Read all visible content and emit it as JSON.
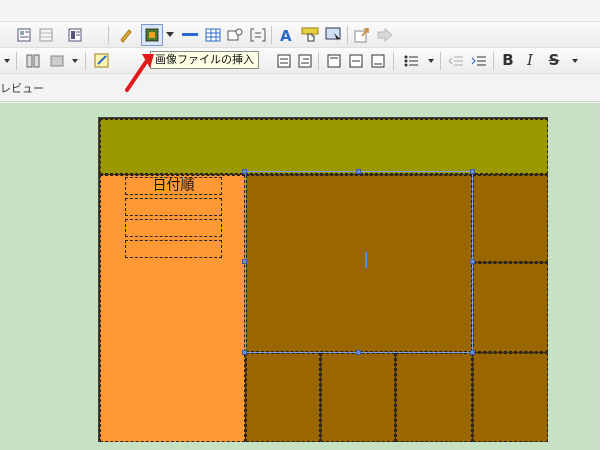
{
  "preview": {
    "label": "レビュー"
  },
  "tooltip": {
    "text": "画像ファイルの挿入"
  },
  "toolbar": {
    "row1_icons": [
      "view-icon",
      "grid-icon",
      "layout-icon",
      "pencil-icon",
      "insert-image-icon",
      "dropdown-arrow-icon",
      "hr-icon",
      "table-icon",
      "form-icon",
      "bracket-icon",
      "text-a-icon",
      "hand-icon",
      "screen-icon",
      "share-icon",
      "forward-icon"
    ],
    "row2_icons": [
      "dropdown-icon",
      "columns-icon",
      "media-icon",
      "note-icon",
      "align-icon",
      "list-icon",
      "indent-icon",
      "outdent-icon"
    ],
    "bold": "B",
    "italic": "I",
    "strike": "S"
  },
  "layout": {
    "sidebar_title": "日付順",
    "colors": {
      "header": "#9a9a00",
      "sidebar": "#ff9933",
      "content": "#996600",
      "canvas": "#c6e2c2"
    }
  }
}
